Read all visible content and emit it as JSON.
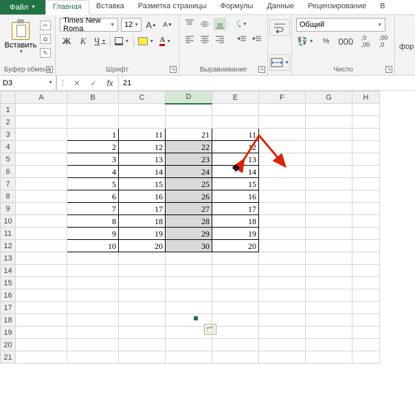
{
  "tabs": {
    "file": "Файл",
    "items": [
      "Главная",
      "Вставка",
      "Разметка страницы",
      "Формулы",
      "Данные",
      "Рецензирование",
      "В"
    ]
  },
  "active_tab_index": 0,
  "ribbon": {
    "clipboard": {
      "paste": "Вставить",
      "label": "Буфер обмена"
    },
    "font": {
      "name": "Times New Roma",
      "size": "12",
      "increase": "A",
      "decrease": "A",
      "bold": "Ж",
      "italic": "К",
      "underline": "Ч",
      "label": "Шрифт"
    },
    "align": {
      "label": "Выравнивание"
    },
    "number": {
      "format": "Общий",
      "label": "Число"
    },
    "extra": "фор"
  },
  "namebox": "D3",
  "formula": "21",
  "columns": [
    "A",
    "B",
    "C",
    "D",
    "E",
    "F",
    "G",
    "H"
  ],
  "selected_col_index": 3,
  "rows_shown": 21,
  "data": {
    "3": {
      "B": "1",
      "C": "11",
      "D": "21",
      "E": "11"
    },
    "4": {
      "B": "2",
      "C": "12",
      "D": "22",
      "E": "12"
    },
    "5": {
      "B": "3",
      "C": "13",
      "D": "23",
      "E": "13"
    },
    "6": {
      "B": "4",
      "C": "14",
      "D": "24",
      "E": "14"
    },
    "7": {
      "B": "5",
      "C": "15",
      "D": "25",
      "E": "15"
    },
    "8": {
      "B": "6",
      "C": "16",
      "D": "26",
      "E": "16"
    },
    "9": {
      "B": "7",
      "C": "17",
      "D": "27",
      "E": "17"
    },
    "10": {
      "B": "8",
      "C": "18",
      "D": "28",
      "E": "18"
    },
    "11": {
      "B": "9",
      "C": "19",
      "D": "29",
      "E": "19"
    },
    "12": {
      "B": "10",
      "C": "20",
      "D": "30",
      "E": "20"
    }
  },
  "selection": {
    "col": "D",
    "rowStart": 3,
    "rowEnd": 12,
    "activeRow": 3
  }
}
